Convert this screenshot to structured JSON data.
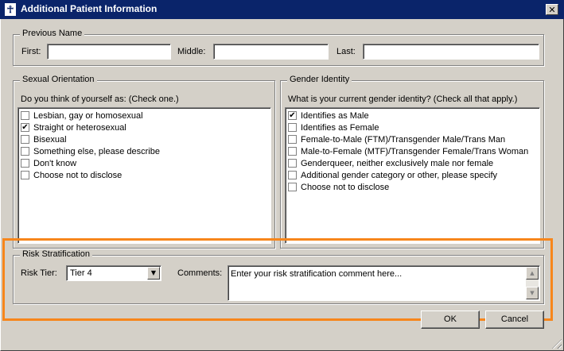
{
  "window": {
    "title": "Additional Patient Information",
    "close_glyph": "✕"
  },
  "previous_name": {
    "legend": "Previous Name",
    "first_label": "First:",
    "first_value": "",
    "middle_label": "Middle:",
    "middle_value": "",
    "last_label": "Last:",
    "last_value": ""
  },
  "sexual_orientation": {
    "legend": "Sexual Orientation",
    "prompt": "Do you think of yourself as:  (Check one.)",
    "options": [
      {
        "label": "Lesbian, gay or homosexual",
        "checked": false
      },
      {
        "label": "Straight or heterosexual",
        "checked": true
      },
      {
        "label": "Bisexual",
        "checked": false
      },
      {
        "label": "Something else, please describe",
        "checked": false
      },
      {
        "label": "Don't know",
        "checked": false
      },
      {
        "label": "Choose not to disclose",
        "checked": false
      }
    ]
  },
  "gender_identity": {
    "legend": "Gender Identity",
    "prompt": "What is your current gender identity?  (Check  all that apply.)",
    "options": [
      {
        "label": "Identifies as Male",
        "checked": true
      },
      {
        "label": "Identifies as Female",
        "checked": false
      },
      {
        "label": "Female-to-Male (FTM)/Transgender Male/Trans Man",
        "checked": false
      },
      {
        "label": "Male-to-Female (MTF)/Transgender Female/Trans Woman",
        "checked": false
      },
      {
        "label": "Genderqueer, neither exclusively male nor female",
        "checked": false
      },
      {
        "label": "Additional gender category or other, please specify",
        "checked": false
      },
      {
        "label": "Choose not to disclose",
        "checked": false
      }
    ]
  },
  "risk_stratification": {
    "legend": "Risk Stratification",
    "tier_label": "Risk Tier:",
    "tier_value": "Tier 4",
    "comments_label": "Comments:",
    "comments_value": "Enter your risk stratification comment here..."
  },
  "buttons": {
    "ok": "OK",
    "cancel": "Cancel"
  },
  "colors": {
    "titlebar": "#0a246a",
    "face": "#d4d0c8",
    "highlight_frame": "#f7861b"
  }
}
